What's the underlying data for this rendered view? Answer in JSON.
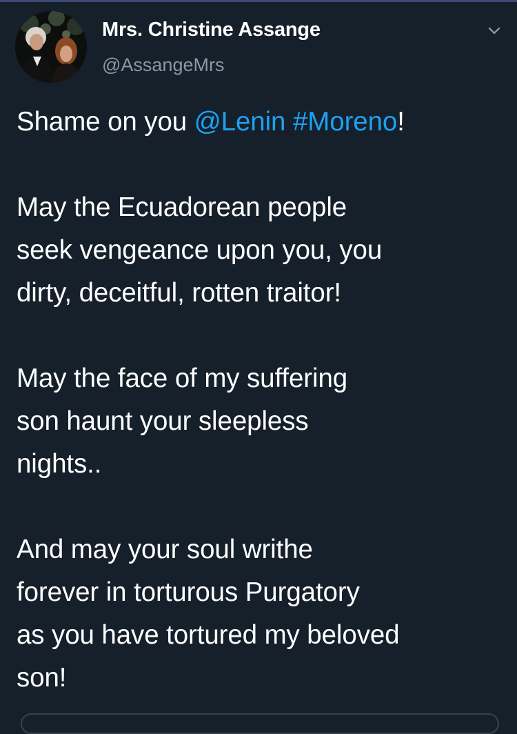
{
  "author": {
    "display_name": "Mrs. Christine Assange",
    "handle": "@AssangeMrs"
  },
  "tweet": {
    "line1_pre": "Shame on you ",
    "mention": "@Lenin",
    "space": " ",
    "hashtag": "#Moreno",
    "line1_post": "!",
    "p2": [
      "May the Ecuadorean people",
      "seek vengeance upon you, you",
      "dirty, deceitful, rotten traitor!"
    ],
    "p3": [
      "May the face of my suffering",
      "son haunt your sleepless",
      "nights.."
    ],
    "p4": [
      "And may your soul writhe",
      "forever in torturous Purgatory",
      "as you have tortured my beloved",
      "son!"
    ]
  },
  "colors": {
    "background": "#15202b",
    "text": "#ffffff",
    "secondary_text": "#8899a6",
    "link": "#1da1f2"
  },
  "icons": {
    "menu": "chevron-down-icon"
  }
}
